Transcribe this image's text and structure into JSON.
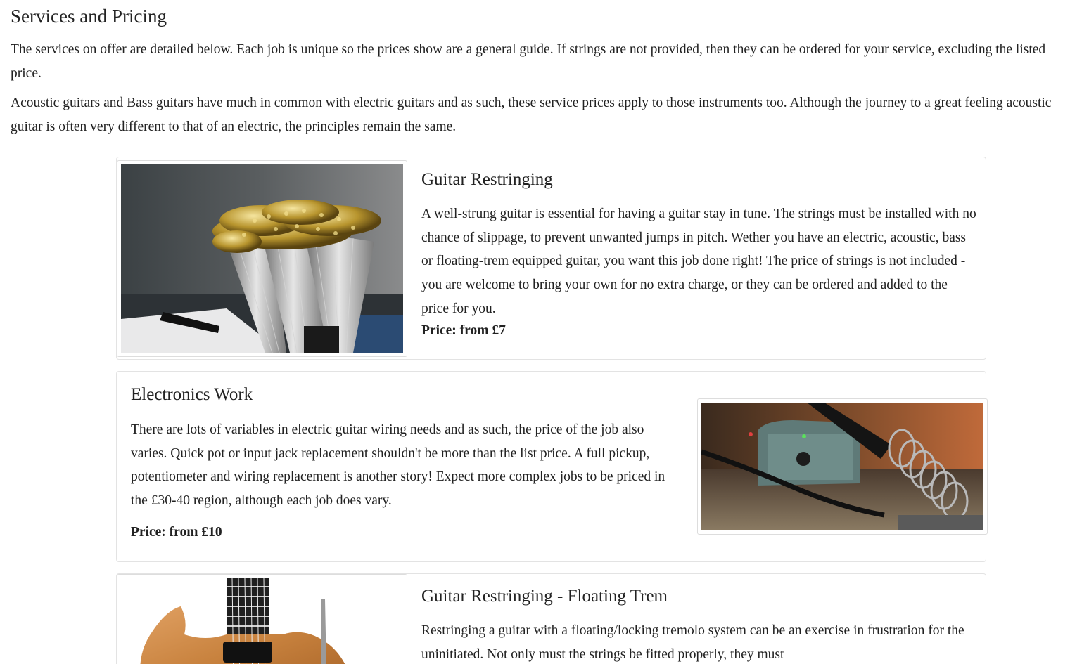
{
  "page": {
    "title": "Services and Pricing",
    "intro_1": "The services on offer are detailed below. Each job is unique so the prices show are a general guide. If strings are not provided, then they can be ordered for your service, excluding the listed price.",
    "intro_2": "Acoustic guitars and Bass guitars have much in common with electric guitars and as such, these service prices apply to those instruments too. Although the journey to a great feeling acoustic guitar is often very different to that of an electric, the principles remain the same."
  },
  "services": [
    {
      "title": "Guitar Restringing",
      "description": "A well-strung guitar is essential for having a guitar stay in tune. The strings must be installed with no chance of slippage, to prevent unwanted jumps in pitch. Wether you have an electric, acoustic, bass or floating-trem equipped guitar, you want this job done right! The price of strings is not included - you are welcome to bring your own for no extra charge, or they can be ordered and added to the price for you.",
      "price": "Price: from £7",
      "image": "guitar-strings-photo"
    },
    {
      "title": "Electronics Work",
      "description": "There are lots of variables in electric guitar wiring needs and as such, the price of the job also varies. Quick pot or input jack replacement shouldn't be more than the list price. A full pickup, potentiometer and wiring replacement is another story! Expect more complex jobs to be priced in the £30-40 region, although each job does vary.",
      "price": "Price: from £10",
      "image": "soldering-iron-photo"
    },
    {
      "title": "Guitar Restringing - Floating Trem",
      "description": "Restringing a guitar with a floating/locking tremolo system can be an exercise in frustration for the uninitiated. Not only must the strings be fitted properly, they must",
      "image": "electric-guitar-body-photo"
    }
  ]
}
